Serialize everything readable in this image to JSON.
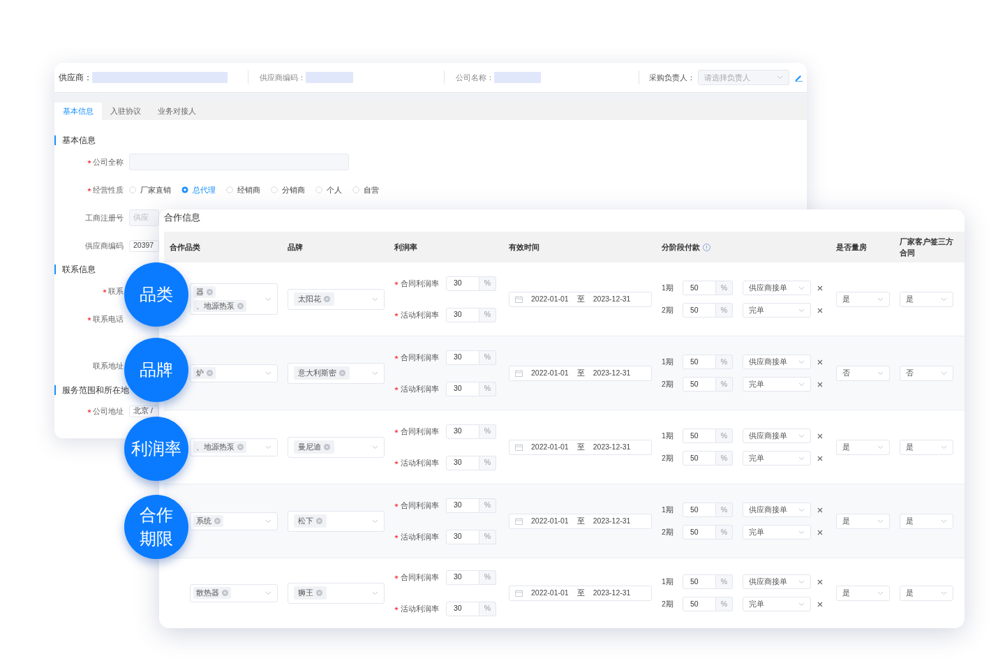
{
  "supplier_window": {
    "header": {
      "supplier_label": "供应商：",
      "code_label": "供应商编码：",
      "company_label": "公司名称：",
      "buyer_label": "采购负责人：",
      "buyer_placeholder": "请选择负责人"
    },
    "tabs": [
      {
        "label": "基本信息",
        "selected": true
      },
      {
        "label": "入驻协议",
        "selected": false
      },
      {
        "label": "业务对接人",
        "selected": false
      }
    ],
    "form": [
      {
        "kind": "section",
        "title": "基本信息"
      },
      {
        "kind": "text",
        "label": "公司全称",
        "required": true
      },
      {
        "kind": "radio",
        "label": "经营性质",
        "required": true,
        "options": [
          {
            "label": "厂家直销",
            "selected": false
          },
          {
            "label": "总代理",
            "selected": true
          },
          {
            "label": "经销商",
            "selected": false
          },
          {
            "label": "分销商",
            "selected": false
          },
          {
            "label": "个人",
            "selected": false
          },
          {
            "label": "自营",
            "selected": false
          }
        ]
      },
      {
        "kind": "text",
        "label": "工商注册号",
        "required": false,
        "placeholder": "供应"
      },
      {
        "kind": "text",
        "label": "供应商编码",
        "required": false,
        "value": "20397"
      },
      {
        "kind": "section",
        "title": "联系信息"
      },
      {
        "kind": "label",
        "label": "联系",
        "required": true
      },
      {
        "kind": "label",
        "label": "联系电话",
        "required": true
      },
      {
        "kind": "label",
        "label": "联系地址",
        "required": false
      },
      {
        "kind": "section",
        "title": "服务范围和所在地"
      },
      {
        "kind": "text",
        "label": "公司地址",
        "required": true,
        "value": "北京 /"
      }
    ]
  },
  "cooperation_window": {
    "title": "合作信息",
    "columns": [
      {
        "label": "合作品类"
      },
      {
        "label": "品牌"
      },
      {
        "label": "利润率"
      },
      {
        "label": "有效时间"
      },
      {
        "label": "分阶段付款",
        "info": true
      },
      {
        "label": "是否量房"
      },
      {
        "label": "厂家客户签三方合同"
      }
    ],
    "rows": [
      {
        "categories": [
          "器",
          "、地源热泵"
        ],
        "brand": "太阳花",
        "rates": [
          {
            "label": "合同利润率",
            "required": true,
            "value": "30",
            "unit": "%"
          },
          {
            "label": "活动利润率",
            "required": true,
            "value": "30",
            "unit": "%"
          }
        ],
        "start": "2022-01-01",
        "separator": "至",
        "end": "2023-12-31",
        "stages": [
          {
            "label": "1期",
            "value": "50",
            "unit": "%",
            "trigger": "供应商接单"
          },
          {
            "label": "2期",
            "value": "50",
            "unit": "%",
            "trigger": "完单"
          }
        ],
        "measure": "是",
        "tripartite": "是"
      },
      {
        "categories": [
          "炉"
        ],
        "brand": "意大利斯密",
        "rates": [
          {
            "label": "合同利润率",
            "required": true,
            "value": "30",
            "unit": "%"
          },
          {
            "label": "活动利润率",
            "required": true,
            "value": "30",
            "unit": "%"
          }
        ],
        "start": "2022-01-01",
        "separator": "至",
        "end": "2023-12-31",
        "stages": [
          {
            "label": "1期",
            "value": "50",
            "unit": "%",
            "trigger": "供应商接单"
          },
          {
            "label": "2期",
            "value": "50",
            "unit": "%",
            "trigger": "完单"
          }
        ],
        "measure": "否",
        "tripartite": "否"
      },
      {
        "categories": [
          "、地源热泵"
        ],
        "brand": "曼尼迪",
        "rates": [
          {
            "label": "合同利润率",
            "required": true,
            "value": "30",
            "unit": "%"
          },
          {
            "label": "活动利润率",
            "required": true,
            "value": "30",
            "unit": "%"
          }
        ],
        "start": "2022-01-01",
        "separator": "至",
        "end": "2023-12-31",
        "stages": [
          {
            "label": "1期",
            "value": "50",
            "unit": "%",
            "trigger": "供应商接单"
          },
          {
            "label": "2期",
            "value": "50",
            "unit": "%",
            "trigger": "完单"
          }
        ],
        "measure": "是",
        "tripartite": "是"
      },
      {
        "categories": [
          "系统"
        ],
        "brand": "松下",
        "rates": [
          {
            "label": "合同利润率",
            "required": true,
            "value": "30",
            "unit": "%"
          },
          {
            "label": "活动利润率",
            "required": true,
            "value": "30",
            "unit": "%"
          }
        ],
        "start": "2022-01-01",
        "separator": "至",
        "end": "2023-12-31",
        "stages": [
          {
            "label": "1期",
            "value": "50",
            "unit": "%",
            "trigger": "供应商接单"
          },
          {
            "label": "2期",
            "value": "50",
            "unit": "%",
            "trigger": "完单"
          }
        ],
        "measure": "是",
        "tripartite": "是"
      },
      {
        "categories": [
          "散热器"
        ],
        "brand": "狮王",
        "rates": [
          {
            "label": "合同利润率",
            "required": true,
            "value": "30",
            "unit": "%"
          },
          {
            "label": "活动利润率",
            "required": true,
            "value": "30",
            "unit": "%"
          }
        ],
        "start": "2022-01-01",
        "separator": "至",
        "end": "2023-12-31",
        "stages": [
          {
            "label": "1期",
            "value": "50",
            "unit": "%",
            "trigger": "供应商接单"
          },
          {
            "label": "2期",
            "value": "50",
            "unit": "%",
            "trigger": "完单"
          }
        ],
        "measure": "是",
        "tripartite": "是"
      }
    ]
  },
  "callouts": [
    {
      "lines": [
        "品类"
      ]
    },
    {
      "lines": [
        "品牌"
      ]
    },
    {
      "lines": [
        "利润率"
      ]
    },
    {
      "lines": [
        "合作",
        "期限"
      ]
    }
  ]
}
